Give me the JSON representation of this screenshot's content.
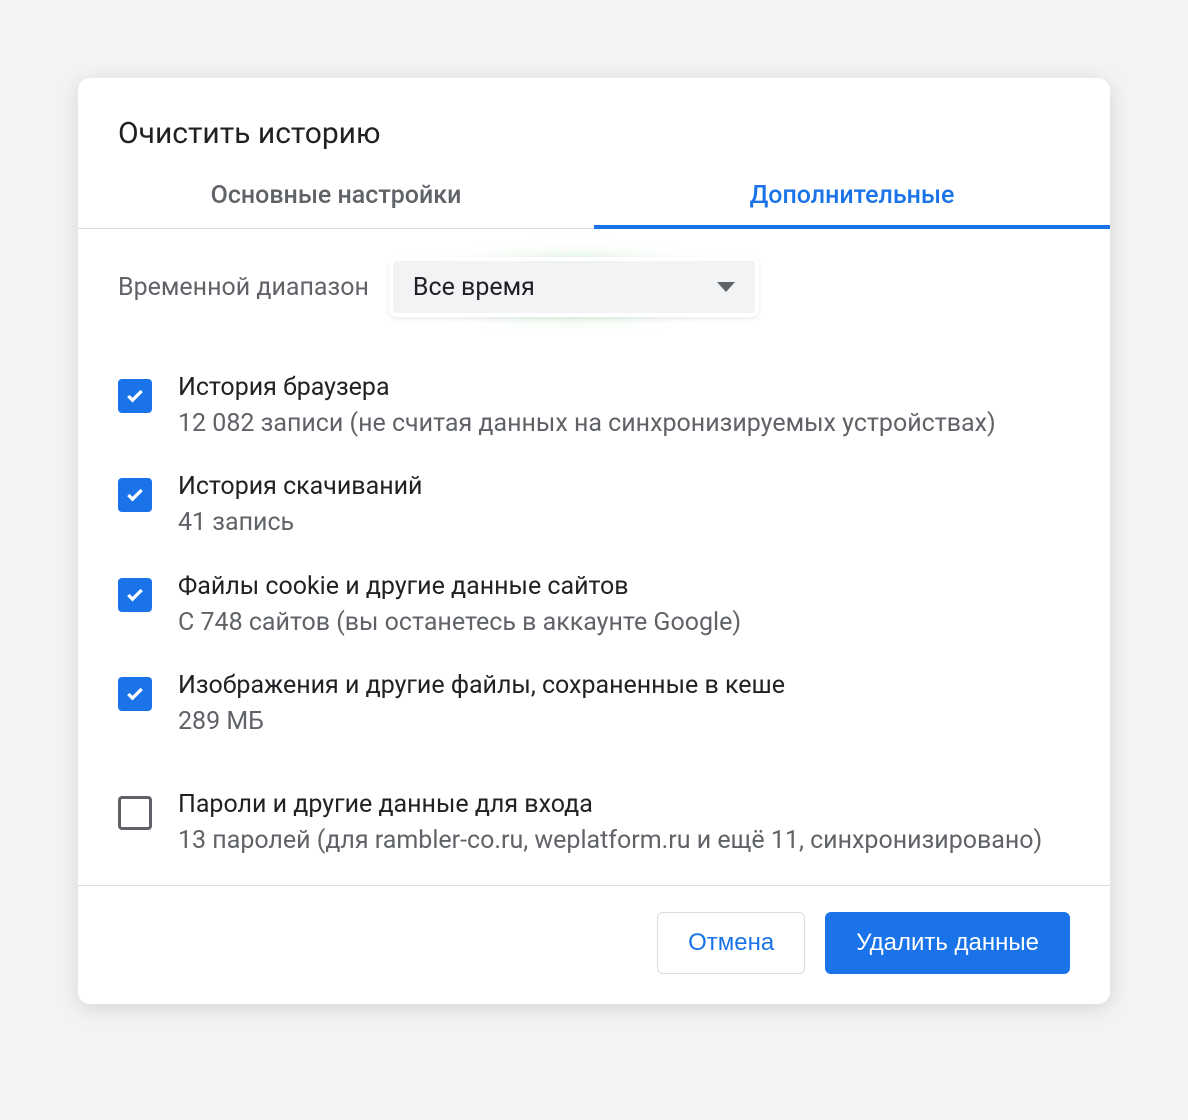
{
  "dialog": {
    "title": "Очистить историю",
    "tabs": {
      "basic": "Основные настройки",
      "advanced": "Дополнительные"
    },
    "time_range": {
      "label": "Временной диапазон",
      "value": "Все время"
    },
    "items": [
      {
        "checked": true,
        "title": "История браузера",
        "subtitle": "12 082 записи (не считая данных на синхронизируемых устройствах)"
      },
      {
        "checked": true,
        "title": "История скачиваний",
        "subtitle": "41 запись"
      },
      {
        "checked": true,
        "title": "Файлы cookie и другие данные сайтов",
        "subtitle": "С 748 сайтов (вы останетесь в аккаунте Google)"
      },
      {
        "checked": true,
        "title": "Изображения и другие файлы, сохраненные в кеше",
        "subtitle": "289 МБ"
      },
      {
        "checked": false,
        "title": "Пароли и другие данные для входа",
        "subtitle": "13 паролей (для rambler-co.ru, weplatform.ru и ещё 11, синхронизировано)"
      }
    ],
    "footer": {
      "cancel": "Отмена",
      "confirm": "Удалить данные"
    }
  }
}
